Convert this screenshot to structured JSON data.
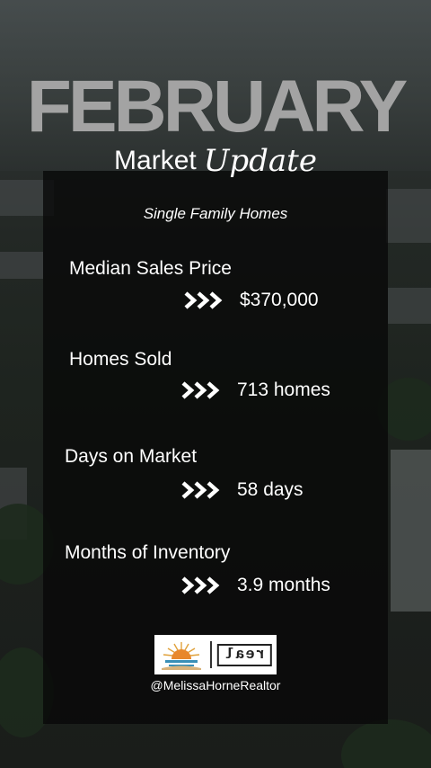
{
  "header": {
    "month": "FEBRUARY",
    "subtitle_main": "Market",
    "subtitle_script": "Update",
    "segment": "Single Family Homes"
  },
  "stats": [
    {
      "label": "Median Sales Price",
      "value": "$370,000"
    },
    {
      "label": "Homes Sold",
      "value": "713 homes"
    },
    {
      "label": "Days on Market",
      "value": "58 days"
    },
    {
      "label": "Months of Inventory",
      "value": "3.9 months"
    }
  ],
  "footer": {
    "brand_text": "real",
    "handle": "@MelissaHorneRealtor"
  },
  "colors": {
    "title_gray": "#a3a3a3",
    "panel": "#080808",
    "text": "#ffffff"
  },
  "icons": [
    "chevrons-right-icon",
    "sunrise-logo-icon"
  ]
}
